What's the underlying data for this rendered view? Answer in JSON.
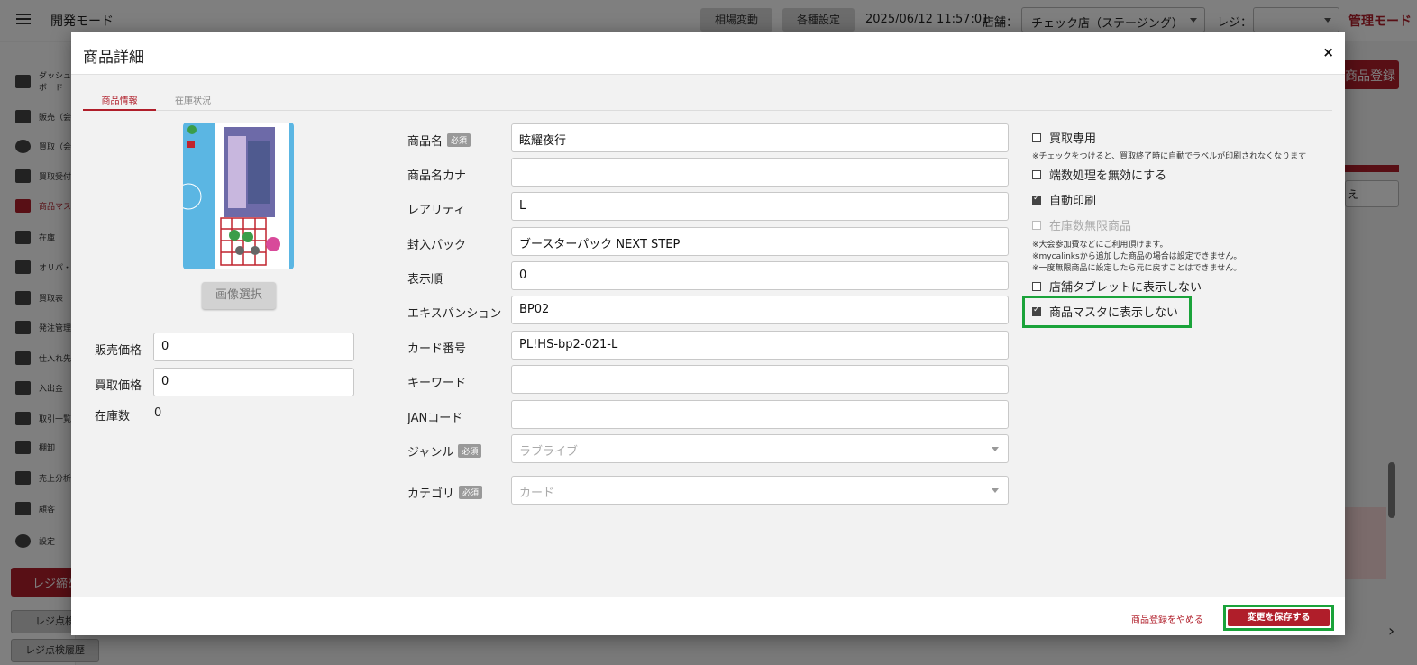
{
  "app": {
    "title": "開発モード",
    "market_button": "相場変動",
    "settings_button": "各種設定",
    "datetime": "2025/06/12 11:57:01",
    "store_label": "店舗：",
    "store_value": "チェック店（ステージング）",
    "register_label": "レジ：",
    "mode": "管理モード",
    "register_product_button": "商品登録",
    "bg_select_text": "え"
  },
  "sidebar": {
    "items": [
      {
        "label": "ダッシュボード"
      },
      {
        "label": "販売（会"
      },
      {
        "label": "買取（会"
      },
      {
        "label": "買取受付"
      },
      {
        "label": "商品マス"
      },
      {
        "label": "在庫"
      },
      {
        "label": "オリパ・"
      },
      {
        "label": "買取表"
      },
      {
        "label": "発注管理"
      },
      {
        "label": "仕入れ先"
      },
      {
        "label": "入出金"
      },
      {
        "label": "取引一覧"
      },
      {
        "label": "棚卸"
      },
      {
        "label": "売上分析"
      },
      {
        "label": "顧客"
      },
      {
        "label": "設定"
      }
    ],
    "close_register": "レジ締め",
    "register_check": "レジ点検",
    "register_check_history": "レジ点検履歴"
  },
  "modal": {
    "title": "商品詳細",
    "close": "×",
    "tabs": [
      {
        "label": "商品情報",
        "active": true
      },
      {
        "label": "在庫状況",
        "active": false
      }
    ],
    "image_select_button": "画像選択",
    "sell_price_label": "販売価格",
    "sell_price_value": "0",
    "buy_price_label": "買取価格",
    "buy_price_value": "0",
    "stock_label": "在庫数",
    "stock_value": "0",
    "required_badge": "必須",
    "fields": {
      "name": {
        "label": "商品名",
        "value": "眩耀夜行"
      },
      "kana": {
        "label": "商品名カナ",
        "value": ""
      },
      "rarity": {
        "label": "レアリティ",
        "value": "L"
      },
      "pack": {
        "label": "封入パック",
        "value": "ブースターパック NEXT STEP"
      },
      "order": {
        "label": "表示順",
        "value": "0"
      },
      "expansion": {
        "label": "エキスパンション",
        "value": "BP02"
      },
      "card_number": {
        "label": "カード番号",
        "value": "PL!HS-bp2-021-L"
      },
      "keyword": {
        "label": "キーワード",
        "value": ""
      },
      "jan": {
        "label": "JANコード",
        "value": ""
      },
      "genre": {
        "label": "ジャンル",
        "placeholder": "ラブライブ"
      },
      "category": {
        "label": "カテゴリ",
        "placeholder": "カード"
      }
    },
    "options": {
      "buy_only": {
        "label": "買取専用",
        "checked": false
      },
      "buy_only_note": "※チェックをつけると、買取終了時に自動でラベルが印刷されなくなります",
      "disable_rounding": {
        "label": "端数処理を無効にする",
        "checked": false
      },
      "auto_print": {
        "label": "自動印刷",
        "checked": true
      },
      "unlimited_stock": {
        "label": "在庫数無限商品",
        "checked": false,
        "disabled": true
      },
      "unlimited_notes": [
        "※大会参加費などにご利用頂けます。",
        "※mycalinksから追加した商品の場合は設定できません。",
        "※一度無限商品に設定したら元に戻すことはできません。"
      ],
      "hide_tablet": {
        "label": "店舗タブレットに表示しない",
        "checked": false
      },
      "hide_master": {
        "label": "商品マスタに表示しない",
        "checked": true
      }
    },
    "footer": {
      "cancel": "商品登録をやめる",
      "save": "変更を保存する"
    }
  },
  "colors": {
    "accent": "#b01e2a",
    "highlight": "#1aa33a"
  }
}
